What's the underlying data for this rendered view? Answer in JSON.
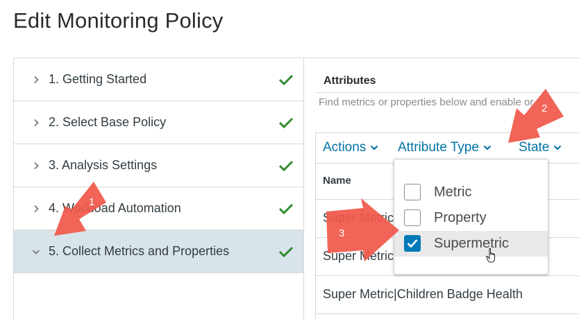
{
  "page_title": "Edit Monitoring Policy",
  "steps": [
    {
      "label": "1. Getting Started",
      "expanded": false,
      "completed": true
    },
    {
      "label": "2. Select Base Policy",
      "expanded": false,
      "completed": true
    },
    {
      "label": "3. Analysis Settings",
      "expanded": false,
      "completed": true
    },
    {
      "label": "4. Workload Automation",
      "expanded": false,
      "completed": true
    },
    {
      "label": "5. Collect Metrics and Properties",
      "expanded": true,
      "completed": true
    }
  ],
  "attributes": {
    "title": "Attributes",
    "help_text": "Find metrics or properties below and enable or"
  },
  "toolbar": {
    "actions_label": "Actions",
    "attribute_type_label": "Attribute Type",
    "state_label": "State"
  },
  "table": {
    "column_name": "Name",
    "rows": [
      "Super Metric",
      "Super Metric",
      "Super Metric|Children Badge Health"
    ]
  },
  "attribute_type_menu": {
    "options": [
      {
        "label": "Metric",
        "checked": false
      },
      {
        "label": "Property",
        "checked": false
      },
      {
        "label": "Supermetric",
        "checked": true
      }
    ]
  },
  "annotations": [
    "1",
    "2",
    "3"
  ],
  "colors": {
    "accent": "#0072a3",
    "check_green": "#2e8b2e",
    "arrow": "#f0584a",
    "active_row": "#d9e4ea",
    "checkbox_checked": "#0079b8"
  },
  "icons": {
    "collapsed": "chevron-right-icon",
    "expanded": "chevron-down-icon",
    "complete": "checkmark-icon",
    "dropdown": "caret-down-icon",
    "pointer": "hand-pointer-cursor-icon"
  }
}
